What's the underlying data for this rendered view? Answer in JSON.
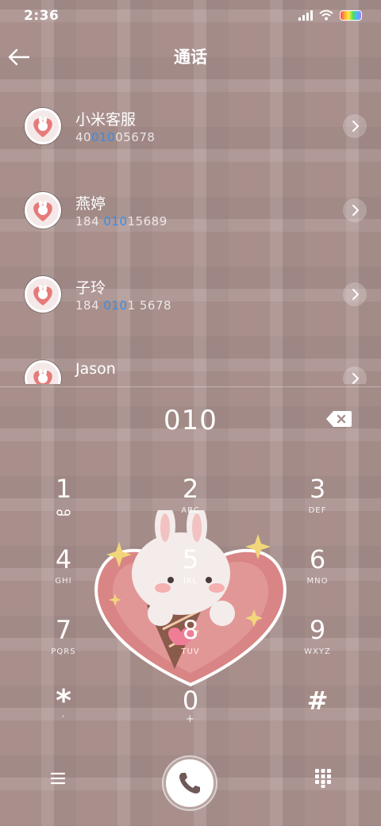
{
  "status": {
    "time": "2:36"
  },
  "header": {
    "title": "通话"
  },
  "contacts": [
    {
      "name": "小米客服",
      "number_pre": "40",
      "number_match": "010",
      "number_post": "05678"
    },
    {
      "name": "燕婷",
      "number_pre": "184 ",
      "number_match": "010",
      "number_post": "15689"
    },
    {
      "name": "子玲",
      "number_pre": "184 ",
      "number_match": "010",
      "number_post": "1 5678"
    },
    {
      "name": "Jason",
      "number_pre": "",
      "number_match": "",
      "number_post": ""
    }
  ],
  "dialer": {
    "input": "010",
    "keys": [
      {
        "digit": "1",
        "letters": ""
      },
      {
        "digit": "2",
        "letters": "ABC"
      },
      {
        "digit": "3",
        "letters": "DEF"
      },
      {
        "digit": "4",
        "letters": "GHI"
      },
      {
        "digit": "5",
        "letters": "JKL"
      },
      {
        "digit": "6",
        "letters": "MNO"
      },
      {
        "digit": "7",
        "letters": "PQRS"
      },
      {
        "digit": "8",
        "letters": "TUV"
      },
      {
        "digit": "9",
        "letters": "WXYZ"
      },
      {
        "digit": "*",
        "letters": ","
      },
      {
        "digit": "0",
        "letters": "+"
      },
      {
        "digit": "#",
        "letters": ""
      }
    ]
  },
  "icons": {
    "back": "back-arrow-icon",
    "backspace": "backspace-icon",
    "menu": "menu-icon",
    "call": "phone-icon",
    "keypad": "keypad-icon",
    "voicemail": "voicemail-icon",
    "chevron": "chevron-right-icon"
  },
  "colors": {
    "highlight": "#2f8ff0",
    "background": "#a88f8c"
  }
}
